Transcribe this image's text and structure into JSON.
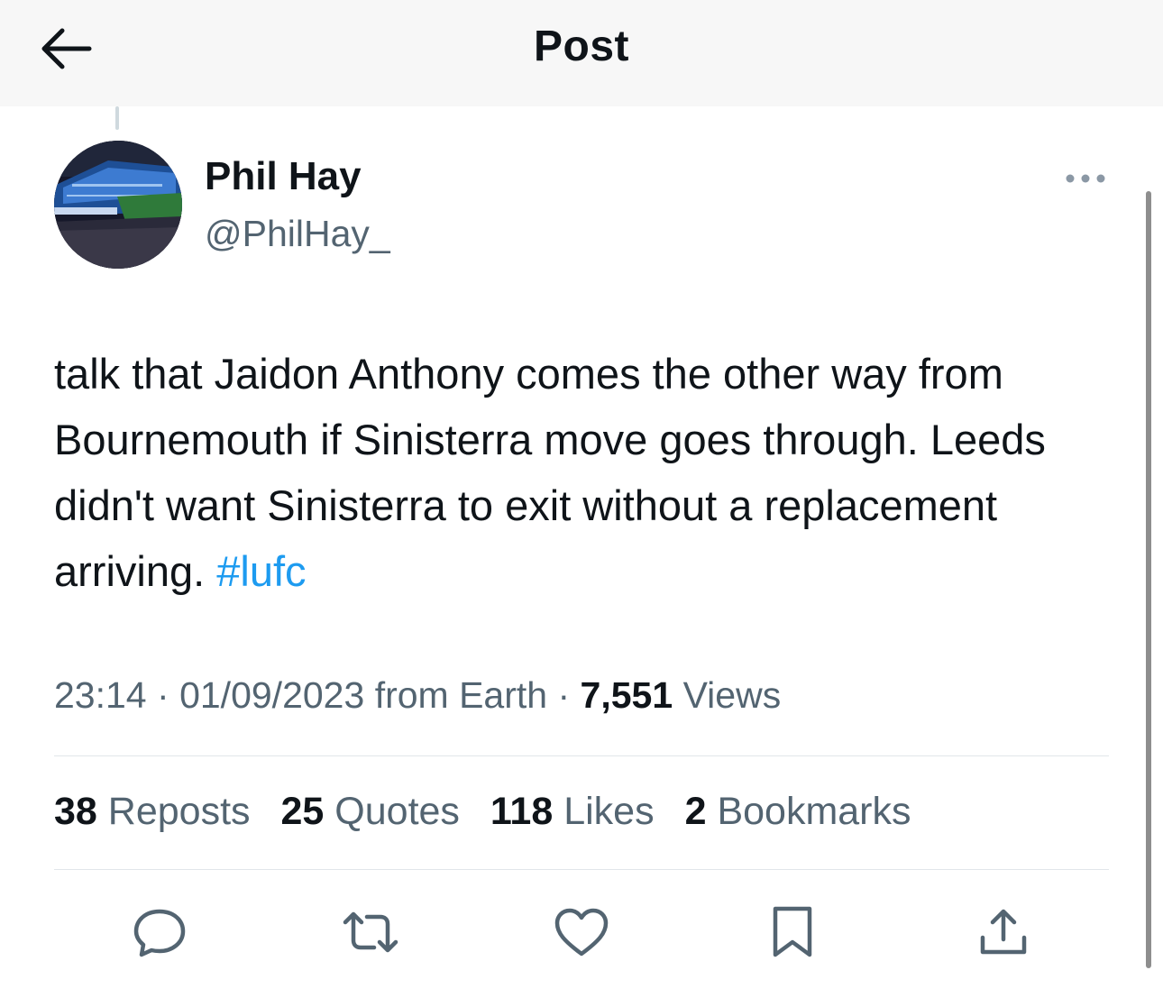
{
  "header": {
    "title": "Post",
    "back_icon": "arrow-left-icon"
  },
  "author": {
    "name": "Phil Hay",
    "handle": "@PhilHay_"
  },
  "tweet": {
    "text": "talk that Jaidon Anthony comes the other way from Bournemouth if Sinisterra move goes through. Leeds didn't want Sinisterra to exit without a replacement arriving.",
    "hashtag": "#lufc"
  },
  "meta": {
    "time": "23:14",
    "separator": "·",
    "date": "01/09/2023",
    "source": "from Earth",
    "views_count": "7,551",
    "views_label": "Views"
  },
  "stats": [
    {
      "count": "38",
      "label": "Reposts"
    },
    {
      "count": "25",
      "label": "Quotes"
    },
    {
      "count": "118",
      "label": "Likes"
    },
    {
      "count": "2",
      "label": "Bookmarks"
    }
  ],
  "actions": [
    "reply-icon",
    "repost-icon",
    "like-icon",
    "bookmark-icon",
    "share-icon"
  ],
  "colors": {
    "text": "#0f1419",
    "secondary": "#536471",
    "link": "#1d9bf0",
    "header_bg": "#f7f7f7",
    "divider": "#e1e6ea"
  }
}
